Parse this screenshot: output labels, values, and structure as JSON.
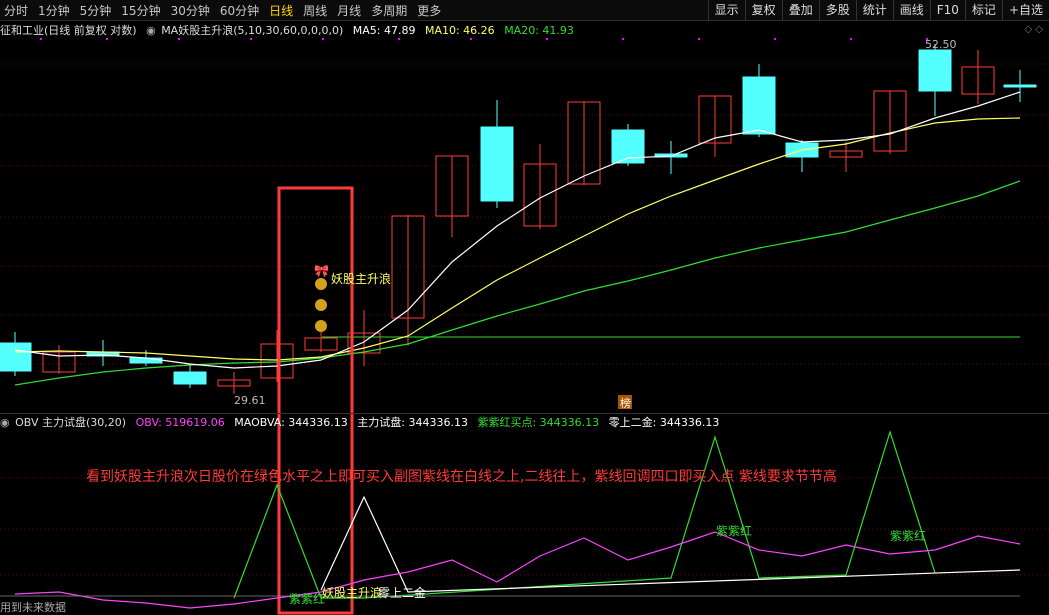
{
  "toolbar": {
    "periods": [
      "分时",
      "1分钟",
      "5分钟",
      "15分钟",
      "30分钟",
      "60分钟",
      "日线",
      "周线",
      "月线",
      "多周期",
      "更多"
    ],
    "active_period": "日线",
    "right_buttons": [
      "显示",
      "复权",
      "叠加",
      "多股",
      "统计",
      "画线",
      "F10",
      "标记",
      "+自选"
    ]
  },
  "main_panel": {
    "stock": "征和工业(日线 前复权 对数)",
    "indicator": "MA妖股主升浪(5,10,30,60,0,0,0,0)",
    "ma5": "MA5: 47.89",
    "ma10": "MA10: 46.26",
    "ma20": "MA20: 41.93",
    "high_label": "52.50",
    "low_label": "29.61",
    "signal_label": "妖股主升浪",
    "badge": "榜"
  },
  "sub_panel": {
    "indicator": "OBV 主力试盘(30,20)",
    "obv": "OBV: 519619.06",
    "maobva": "MAOBVA: 344336.13",
    "zhulishipan": "主力试盘: 344336.13",
    "zzh_buy": "紫紫红买点: 344336.13",
    "zero_gold": "零上二金: 344336.13",
    "note": "看到妖股主升浪次日股价在绿色水平之上即可买入副图紫线在白线之上,二线往上，紫线回调四口即买入点 紫线要求节节高",
    "label_zzh1": "紫紫红",
    "label_zzh2": "紫紫红",
    "label_zzh3": "紫紫红",
    "label_signal": "妖股主升浪",
    "label_zero": "零上二金"
  },
  "footer": {
    "tip": "用到未来数据"
  },
  "colors": {
    "up": "#ff3b3b",
    "down": "#54ffff",
    "ma5": "#ffffff",
    "ma10": "#ffff66",
    "ma20": "#33dd33",
    "purple": "#ff44ff",
    "green": "#33dd33",
    "orange": "#ff9900"
  }
}
